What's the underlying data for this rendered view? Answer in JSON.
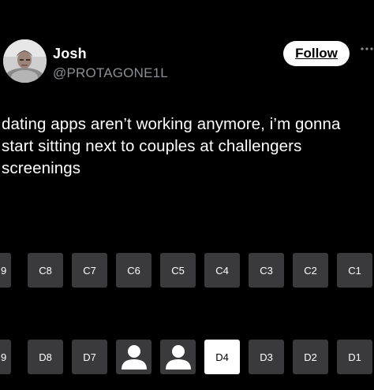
{
  "header": {
    "name": "Josh",
    "handle": "@PROTAGONE1L",
    "follow_label": "Follow",
    "more_icon": "ellipsis-icon"
  },
  "tweet": {
    "text": "dating apps aren’t working anymore, i’m gonna start sitting next to couples at challengers screenings"
  },
  "seat_map": {
    "colors": {
      "seat": "#3a3a3c",
      "selected": "#ffffff",
      "taken_icon": "#ffffff"
    },
    "row_c": [
      "9",
      "C8",
      "C7",
      "C6",
      "C5",
      "C4",
      "C3",
      "C2",
      "C1"
    ],
    "row_d": [
      "9",
      "D8",
      "D7",
      "",
      "",
      "D4",
      "D3",
      "D2",
      "D1"
    ],
    "taken_seats": [
      "D6",
      "D5"
    ],
    "selected_seat": "D4"
  }
}
